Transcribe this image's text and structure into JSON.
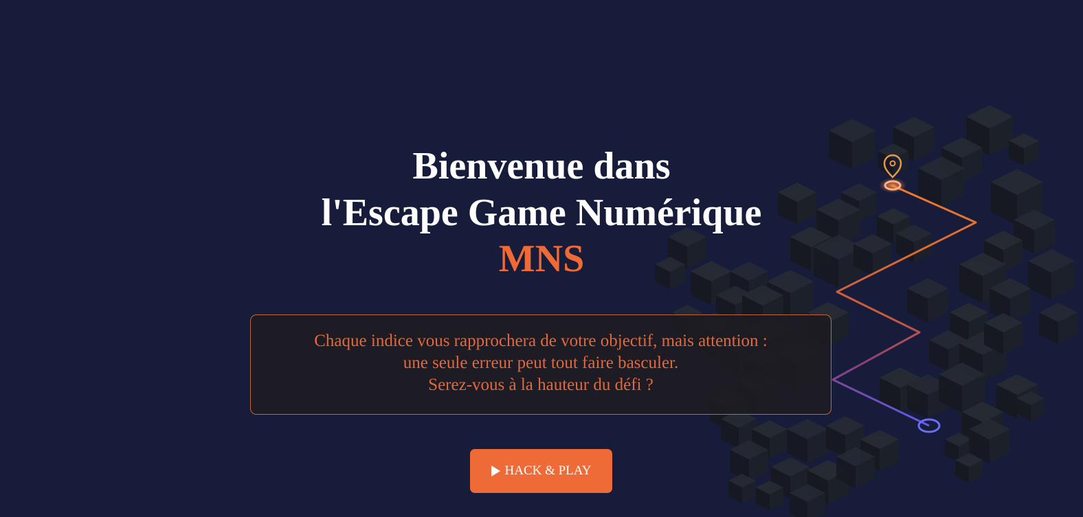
{
  "hero": {
    "title_line1": "Bienvenue dans",
    "title_line2": "l'Escape Game Numérique",
    "title_accent": "MNS"
  },
  "message": {
    "line1": "Chaque indice vous rapprochera de votre objectif, mais attention :",
    "line2": "une seule erreur peut tout faire basculer.",
    "line3": "Serez-vous à la hauteur du défi ?"
  },
  "cta": {
    "label": "HACK & PLAY",
    "icon": "play-icon"
  },
  "theme": {
    "background": "#161c3a",
    "accent": "#ee6a36",
    "path_start": "#f07a2a",
    "path_end": "#5b5cf0"
  },
  "illustration": {
    "icons": [
      "location-pin-icon",
      "start-node-icon",
      "end-node-icon"
    ]
  }
}
